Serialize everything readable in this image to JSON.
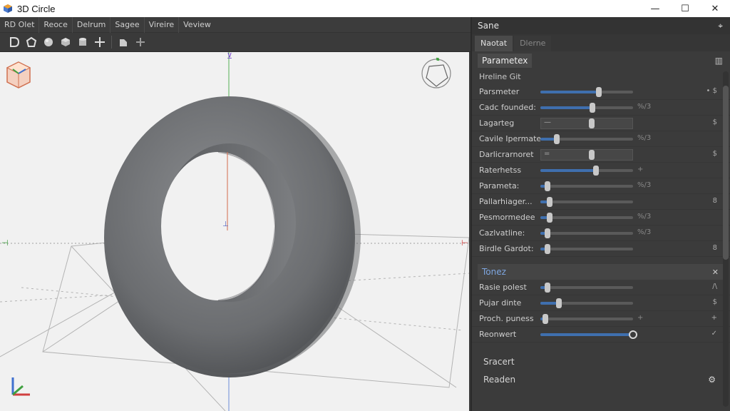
{
  "window": {
    "title": "3D Circle",
    "minimize_glyph": "—",
    "maximize_glyph": "☐",
    "close_glyph": "✕"
  },
  "menu": [
    "RD Olet",
    "Reoce",
    "Delrum",
    "Sagee",
    "Vireire",
    "Veview"
  ],
  "toolbar": {
    "icons": [
      "play-icon",
      "pentagon-icon",
      "sphere-icon",
      "cube-icon",
      "cylinder-icon",
      "move-icon",
      "select-icon",
      "add-icon"
    ]
  },
  "panel": {
    "header_title": "Sane",
    "header_pin": "⌖",
    "tabs": [
      "Naotat",
      "Dlerne"
    ],
    "sub_header_label": "Parametex",
    "sub_header_pin": "▥",
    "section_title": "Hreline Git",
    "params": [
      {
        "label": "Parsmeter",
        "end": "•   $",
        "value": 0.63
      },
      {
        "label": "Cadc founded:",
        "mid": "%/3",
        "value": 0.56
      },
      {
        "label": "Lagarteg",
        "box_text": "—",
        "end": "$",
        "value": 0.55
      },
      {
        "label": "Cavile Ipermate",
        "mid": "%/3",
        "value": 0.18
      },
      {
        "label": "Darlicrarnoret",
        "box_text": "=",
        "end": "$",
        "value": 0.55
      },
      {
        "label": "Raterhetss",
        "mid": "+",
        "value": 0.6
      },
      {
        "label": "Parameta:",
        "mid": "%/3",
        "value": 0.08
      },
      {
        "label": "Pallarhiager...",
        "end": "8",
        "value": 0.1
      },
      {
        "label": "Pesmormedee",
        "mid": "%/3",
        "value": 0.1
      },
      {
        "label": "Cazlvatline:",
        "mid": "%/3",
        "value": 0.08
      },
      {
        "label": "Birdle Gardot:",
        "end": "8",
        "value": 0.08
      }
    ],
    "section2": {
      "title": "Tonez",
      "close": "✕",
      "rows": [
        {
          "label": "Rasie polest",
          "end": "/\\",
          "value": 0.08
        },
        {
          "label": "Pujar dinte",
          "end": "$",
          "value": 0.2
        },
        {
          "label": "Proch. puness",
          "mid": "+",
          "end": "+",
          "value": 0.05
        },
        {
          "label": "Reonwert",
          "end": "✓",
          "value": 1.0
        }
      ]
    },
    "footer": [
      {
        "label": "Sracert",
        "icon": ""
      },
      {
        "label": "Readen",
        "icon": "⚙"
      }
    ]
  },
  "colors": {
    "accent_blue": "#3f6fae",
    "viewport_bg": "#f1f1f1",
    "panel_bg": "#3b3b3b",
    "torus": "#6d6f72"
  }
}
